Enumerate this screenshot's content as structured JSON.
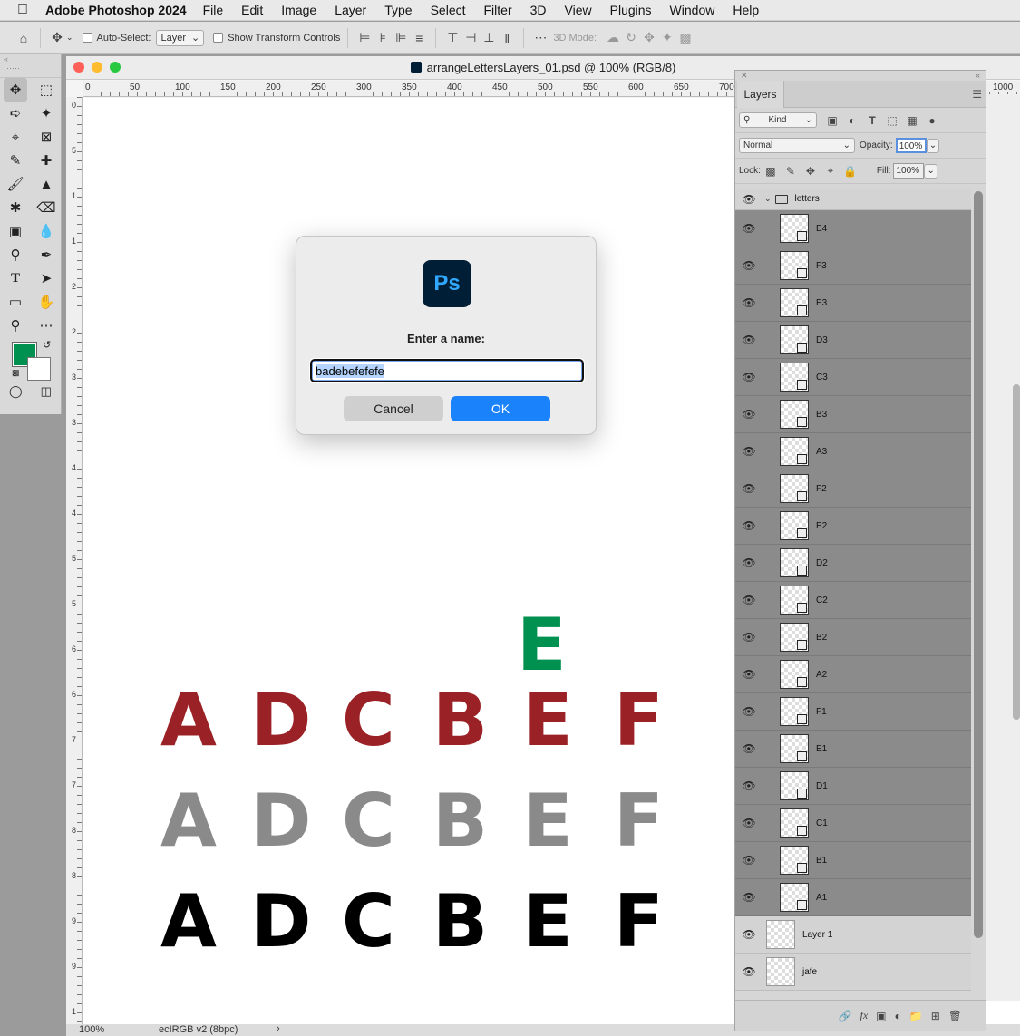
{
  "menubar": {
    "app": "Adobe Photoshop 2024",
    "items": [
      "File",
      "Edit",
      "Image",
      "Layer",
      "Type",
      "Select",
      "Filter",
      "3D",
      "View",
      "Plugins",
      "Window",
      "Help"
    ]
  },
  "options": {
    "auto_select_label": "Auto-Select:",
    "auto_select_value": "Layer",
    "show_transform_label": "Show Transform Controls",
    "mode_3d_label": "3D Mode:"
  },
  "document": {
    "title": "arrangeLettersLayers_01.psd @ 100% (RGB/8)",
    "ruler_h": [
      "0",
      "50",
      "100",
      "150",
      "200",
      "250",
      "300",
      "350",
      "400",
      "450",
      "500",
      "550",
      "600",
      "650",
      "700",
      "1000"
    ],
    "ruler_v": [
      "0",
      "5",
      "1",
      "1",
      "2",
      "2",
      "3",
      "3",
      "4",
      "4",
      "5",
      "5",
      "6",
      "6",
      "7",
      "7",
      "8",
      "8",
      "9",
      "9",
      "1"
    ],
    "status_zoom": "100%",
    "status_profile": "ecIRGB v2 (8bpc)",
    "green_letter": "E",
    "row_red": [
      "A",
      "D",
      "C",
      "B",
      "E",
      "F"
    ],
    "row_gray": [
      "A",
      "D",
      "C",
      "B",
      "E",
      "F"
    ],
    "row_black": [
      "A",
      "D",
      "C",
      "B",
      "E",
      "F"
    ]
  },
  "colors": {
    "red": "#9a2226",
    "gray": "#8a8a8a",
    "black": "#000000",
    "green": "#00904f",
    "foreground_swatch": "#009150"
  },
  "dialog": {
    "prompt": "Enter a name:",
    "input_value": "badebefefefe",
    "cancel_label": "Cancel",
    "ok_label": "OK",
    "logo_text": "Ps"
  },
  "layers_panel": {
    "tab": "Layers",
    "filter_kind": "Kind",
    "blend_mode": "Normal",
    "opacity_label": "Opacity:",
    "opacity_value": "100%",
    "lock_label": "Lock:",
    "fill_label": "Fill:",
    "fill_value": "100%",
    "group_name": "letters",
    "smart_layers": [
      "E4",
      "F3",
      "E3",
      "D3",
      "C3",
      "B3",
      "A3",
      "F2",
      "E2",
      "D2",
      "C2",
      "B2",
      "A2",
      "F1",
      "E1",
      "D1",
      "C1",
      "B1",
      "A1"
    ],
    "plain_layers": [
      "Layer 1",
      "jafe"
    ]
  }
}
